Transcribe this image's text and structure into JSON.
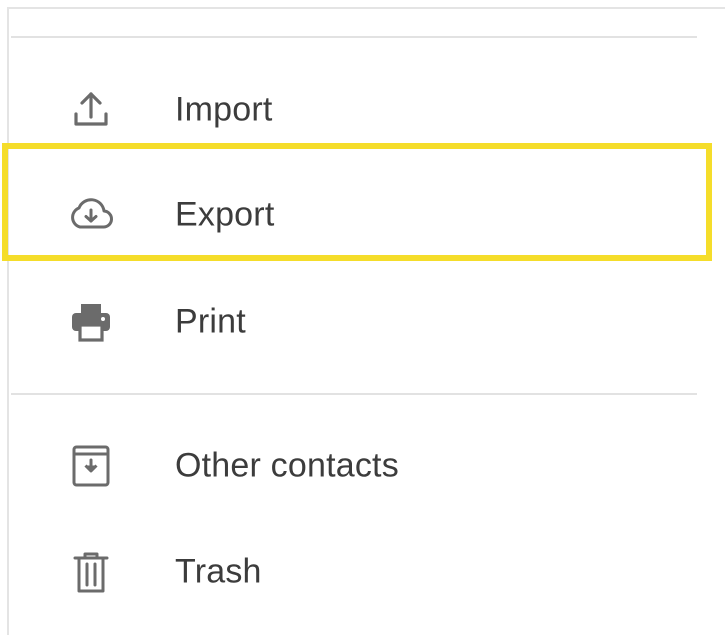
{
  "menu": {
    "items": [
      {
        "id": "import",
        "label": "Import",
        "icon": "upload-icon"
      },
      {
        "id": "export",
        "label": "Export",
        "icon": "cloud-download-icon"
      },
      {
        "id": "print",
        "label": "Print",
        "icon": "printer-icon"
      },
      {
        "id": "other_contacts",
        "label": "Other contacts",
        "icon": "archive-download-icon"
      },
      {
        "id": "trash",
        "label": "Trash",
        "icon": "trash-icon"
      }
    ],
    "highlighted_item": "export",
    "highlight_color": "#f5dd2a",
    "icon_color": "#6b6b6b",
    "text_color": "#3c3c3c"
  }
}
